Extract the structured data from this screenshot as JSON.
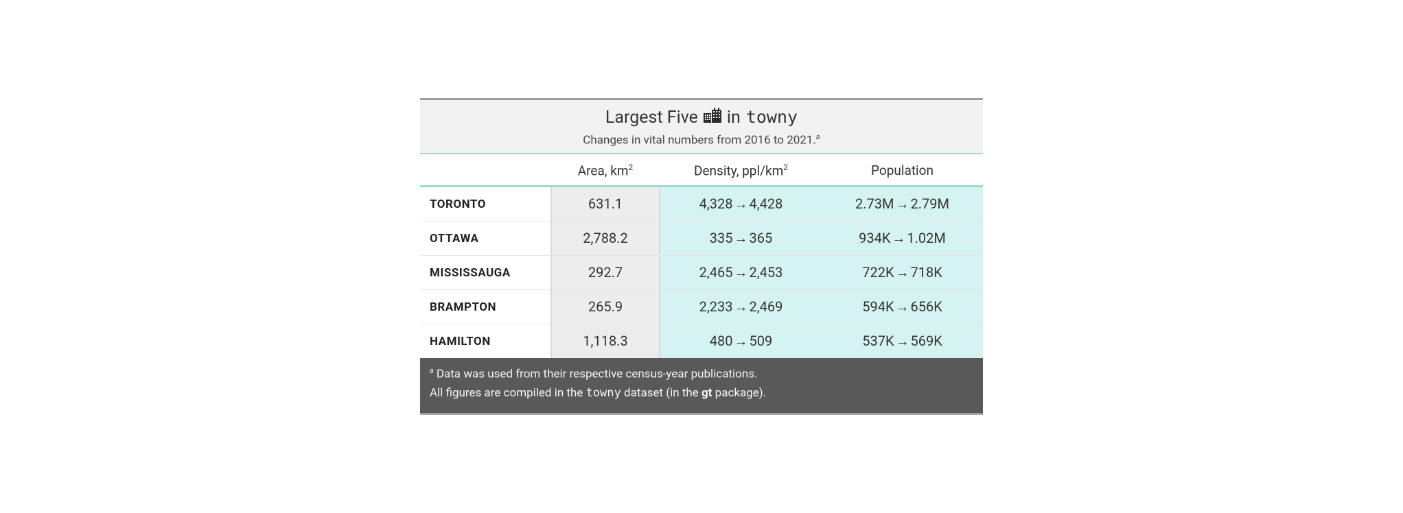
{
  "header": {
    "title_pre": "Largest Five",
    "title_in": "in",
    "title_mono": "towny",
    "subtitle_text": "Changes in vital numbers from 2016 to 2021.",
    "subtitle_mark": "a"
  },
  "columns": {
    "stub": "",
    "area_label": "Area, km",
    "area_sup": "2",
    "density_label": "Density, ppl/km",
    "density_sup": "2",
    "population_label": "Population"
  },
  "rows": [
    {
      "name": "TORONTO",
      "area": "631.1",
      "density_from": "4,328",
      "density_to": "4,428",
      "pop_from": "2.73M",
      "pop_to": "2.79M"
    },
    {
      "name": "OTTAWA",
      "area": "2,788.2",
      "density_from": "335",
      "density_to": "365",
      "pop_from": "934K",
      "pop_to": "1.02M"
    },
    {
      "name": "MISSISSAUGA",
      "area": "292.7",
      "density_from": "2,465",
      "density_to": "2,453",
      "pop_from": "722K",
      "pop_to": "718K"
    },
    {
      "name": "BRAMPTON",
      "area": "265.9",
      "density_from": "2,233",
      "density_to": "2,469",
      "pop_from": "594K",
      "pop_to": "656K"
    },
    {
      "name": "HAMILTON",
      "area": "1,118.3",
      "density_from": "480",
      "density_to": "509",
      "pop_from": "537K",
      "pop_to": "569K"
    }
  ],
  "footer": {
    "note_mark": "a",
    "note_text": "Data was used from their respective census-year publications.",
    "line2_pre": "All figures are compiled in the ",
    "line2_mono": "towny",
    "line2_mid": " dataset (in the ",
    "line2_bold": "gt",
    "line2_post": " package)."
  },
  "chart_data": {
    "type": "table",
    "title": "Largest Five cities in towny — Changes in vital numbers from 2016 to 2021",
    "columns": [
      "City",
      "Area_km2",
      "Density_2016_ppl_per_km2",
      "Density_2021_ppl_per_km2",
      "Population_2016",
      "Population_2021"
    ],
    "rows": [
      [
        "Toronto",
        631.1,
        4328,
        4428,
        2730000,
        2790000
      ],
      [
        "Ottawa",
        2788.2,
        335,
        365,
        934000,
        1020000
      ],
      [
        "Mississauga",
        292.7,
        2465,
        2453,
        722000,
        718000
      ],
      [
        "Brampton",
        265.9,
        2233,
        2469,
        594000,
        656000
      ],
      [
        "Hamilton",
        1118.3,
        480,
        509,
        537000,
        569000
      ]
    ]
  }
}
